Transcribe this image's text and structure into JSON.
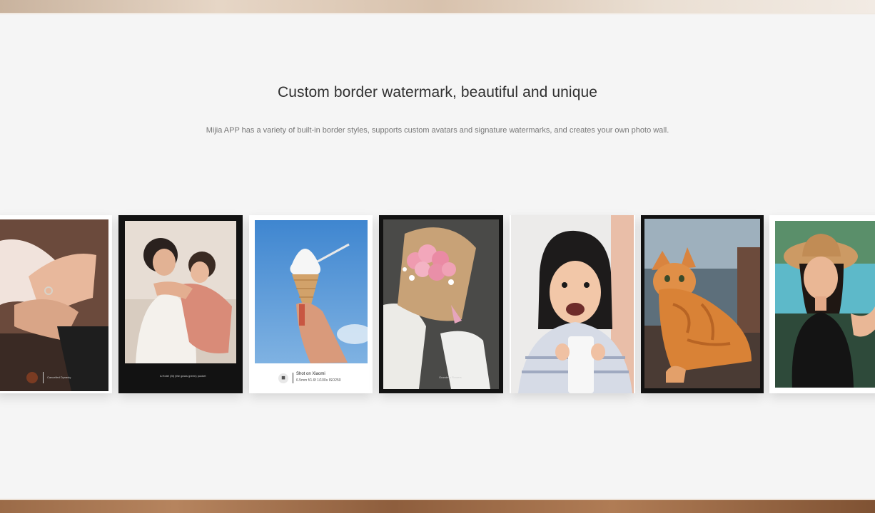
{
  "header": {
    "title": "Custom border watermark, beautiful and unique",
    "subtitle": "Mijia APP has a variety of built-in border styles, supports custom avatars and signature watermarks, and creates your own photo wall."
  },
  "photo_wall": {
    "cards": [
      {
        "subject": "hands",
        "frame": "white",
        "caption": "Cancelled Dynasty"
      },
      {
        "subject": "mother-and-daughter",
        "frame": "black",
        "caption": "A Hotel (3t) (the grass green) pocket"
      },
      {
        "subject": "ice-cream",
        "frame": "white",
        "watermark_title": "Shot on Xiaomi",
        "watermark_specs": "6.5mm f/1.6f 1/100s ISO250"
      },
      {
        "subject": "flowers",
        "frame": "black",
        "caption": "Grandma Flowers"
      },
      {
        "subject": "child-with-milk",
        "frame": "white"
      },
      {
        "subject": "cat",
        "frame": "black"
      },
      {
        "subject": "woman-with-hat",
        "frame": "white"
      }
    ]
  },
  "colors": {
    "page_background": "#f5f5f5",
    "title_text": "#2f2f2f",
    "subtitle_text": "#777777",
    "frame_white": "#ffffff",
    "frame_black": "#121212"
  }
}
